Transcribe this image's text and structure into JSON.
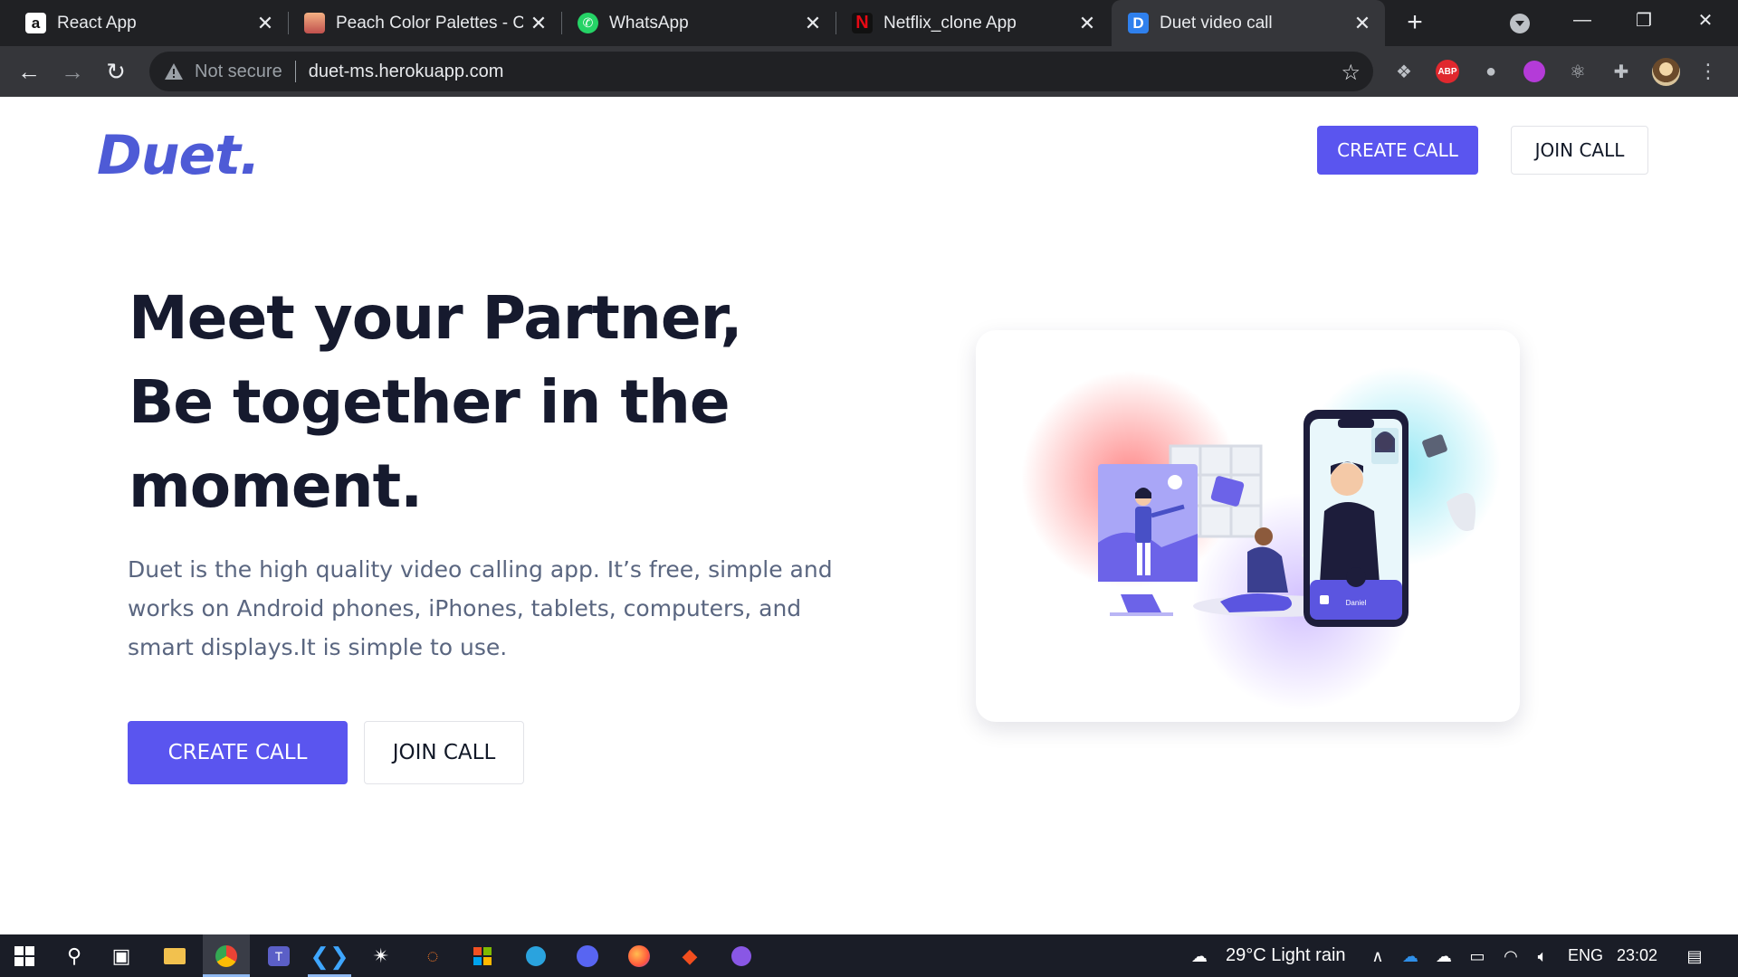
{
  "browser": {
    "tabs": [
      {
        "title": "React App",
        "icon": "react-a-icon"
      },
      {
        "title": "Peach Color Palettes - Col",
        "icon": "palette-icon"
      },
      {
        "title": "WhatsApp",
        "icon": "whatsapp-icon"
      },
      {
        "title": "Netflix_clone App",
        "icon": "netflix-icon"
      },
      {
        "title": "Duet video call",
        "icon": "duet-d-icon"
      }
    ],
    "new_tab": "+",
    "security_label": "Not secure",
    "url": "duet-ms.herokuapp.com",
    "abp_label": "ABP"
  },
  "header": {
    "logo": "Duet.",
    "create_label": "CREATE CALL",
    "join_label": "JOIN CALL"
  },
  "hero": {
    "title_line1": "Meet your Partner,",
    "title_line2": "Be together in the",
    "title_line3": "moment.",
    "description": "Duet is the high quality video calling app. It’s free, simple and works on Android phones, iPhones, tablets, computers, and smart displays.It is simple to use.",
    "create_label": "CREATE CALL",
    "join_label": "JOIN CALL",
    "phone_name": "Daniel"
  },
  "taskbar": {
    "weather": "29°C  Light rain",
    "language": "ENG",
    "time": "23:02"
  },
  "colors": {
    "brand": "#5a55ef",
    "logo": "#4e5bd6",
    "title": "#161a2e",
    "body_text": "#5a6680"
  }
}
